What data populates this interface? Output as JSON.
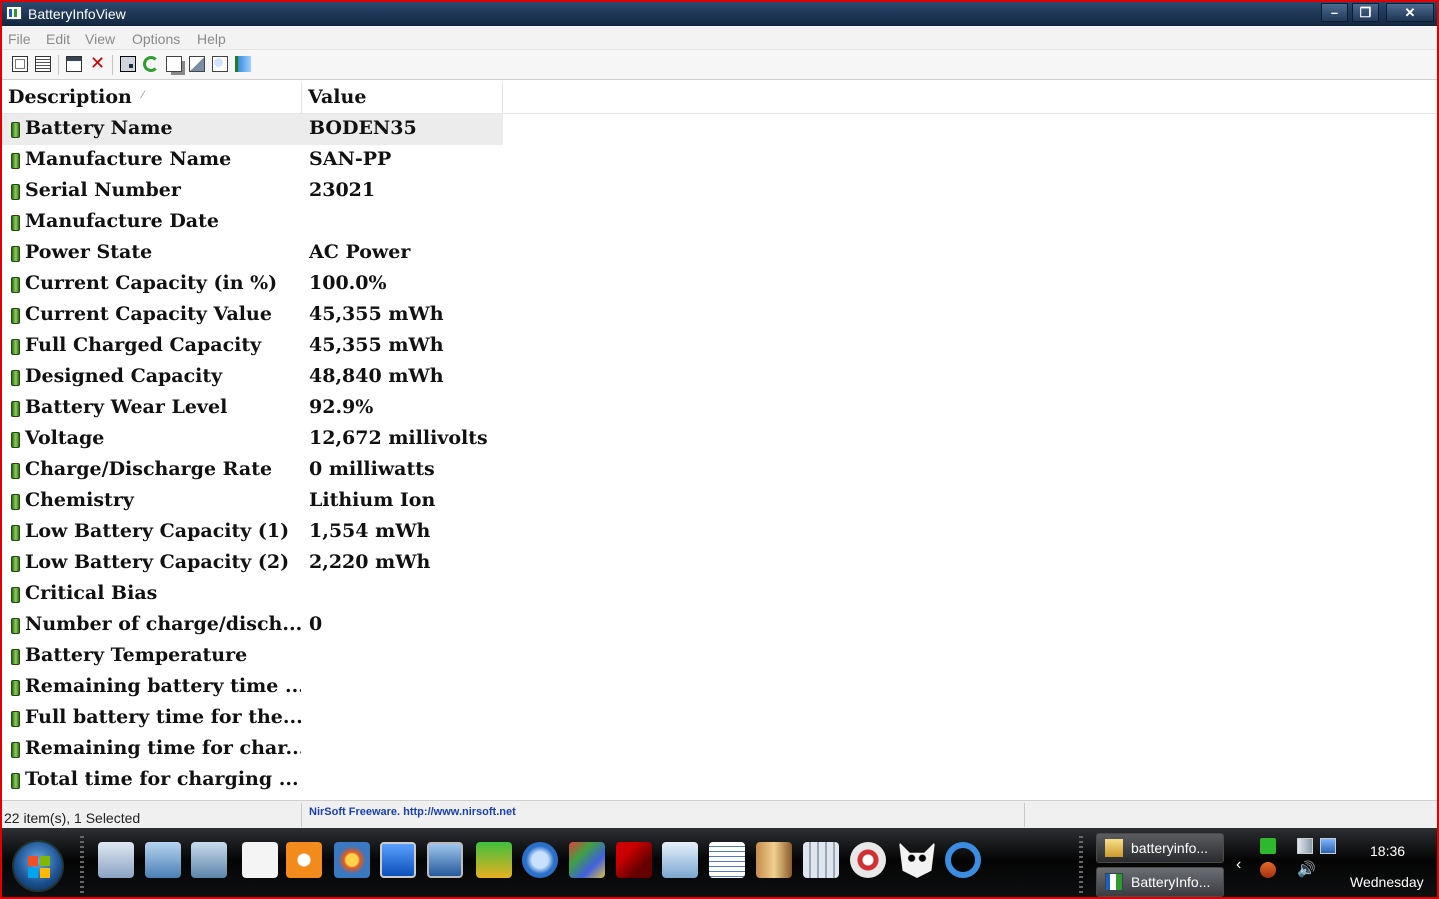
{
  "window": {
    "title": "BatteryInfoView",
    "minimize_label": "–",
    "restore_label": "❐",
    "close_label": "✕"
  },
  "menu": [
    "File",
    "Edit",
    "View",
    "Options",
    "Help"
  ],
  "toolbar_icons": [
    "html-report-all-icon",
    "html-report-selected-icon",
    "properties-icon",
    "close-x-icon",
    "save-icon",
    "refresh-icon",
    "copy-icon",
    "options-icon",
    "find-icon",
    "exit-icon"
  ],
  "columns": {
    "description": "Description",
    "value": "Value"
  },
  "rows": [
    {
      "desc": "Battery Name",
      "val": "BODEN35"
    },
    {
      "desc": "Manufacture Name",
      "val": "SAN-PP"
    },
    {
      "desc": "Serial Number",
      "val": "23021"
    },
    {
      "desc": "Manufacture Date",
      "val": ""
    },
    {
      "desc": "Power State",
      "val": "AC Power"
    },
    {
      "desc": "Current Capacity (in %)",
      "val": "100.0%"
    },
    {
      "desc": "Current Capacity Value",
      "val": "45,355 mWh"
    },
    {
      "desc": "Full Charged Capacity",
      "val": "45,355 mWh"
    },
    {
      "desc": "Designed Capacity",
      "val": "48,840 mWh"
    },
    {
      "desc": "Battery Wear Level",
      "val": "92.9%"
    },
    {
      "desc": "Voltage",
      "val": "12,672 millivolts"
    },
    {
      "desc": "Charge/Discharge Rate",
      "val": "0 milliwatts"
    },
    {
      "desc": "Chemistry",
      "val": "Lithium Ion"
    },
    {
      "desc": "Low Battery Capacity (1)",
      "val": "1,554 mWh"
    },
    {
      "desc": "Low Battery Capacity (2)",
      "val": "2,220 mWh"
    },
    {
      "desc": "Critical Bias",
      "val": ""
    },
    {
      "desc": "Number of charge/disch...",
      "val": "0"
    },
    {
      "desc": "Battery Temperature",
      "val": ""
    },
    {
      "desc": "Remaining battery time ...",
      "val": ""
    },
    {
      "desc": "Full battery time for the...",
      "val": ""
    },
    {
      "desc": "Remaining time for char...",
      "val": ""
    },
    {
      "desc": "Total  time for charging ...",
      "val": ""
    }
  ],
  "selected_row": "Battery Name",
  "status": {
    "items": "22 item(s), 1 Selected",
    "credit": "NirSoft Freeware.  http://www.nirsoft.net"
  },
  "taskbar": {
    "tasks": [
      "batteryinfo...",
      "BatteryInfo..."
    ],
    "clock": "18:36",
    "day": "Wednesday"
  },
  "colors": {
    "titlebar": "#14263f",
    "frame_border": "#e00000",
    "battery_icon": "#5fa83a",
    "status_link": "#1a3fb0"
  }
}
